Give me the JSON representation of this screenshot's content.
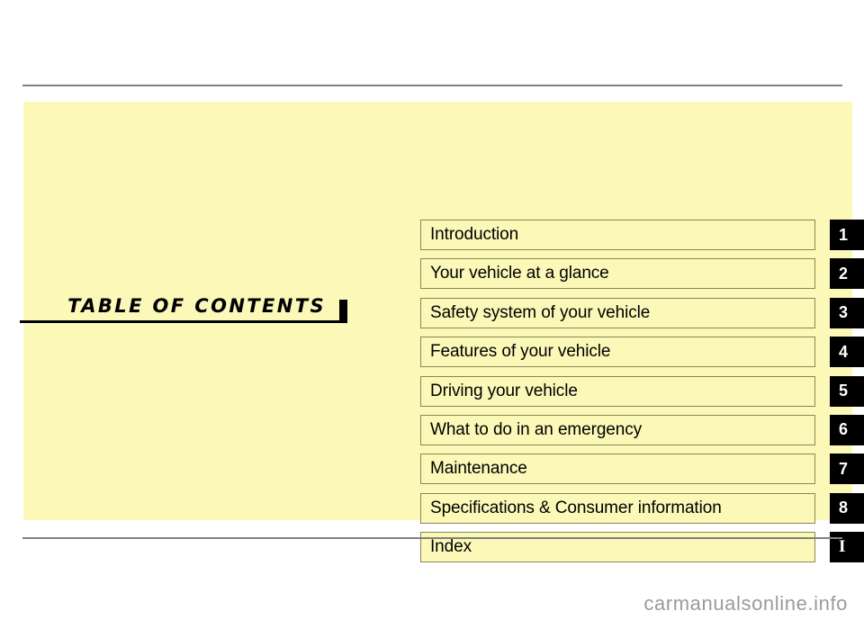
{
  "page": {
    "title": "TABLE OF CONTENTS",
    "title_plain": "TABLE OF CONTENTS",
    "panel_color": "#fbf8b8",
    "rule_color": "#808080",
    "tab_color": "#000000",
    "tab_text_color": "#ffffff"
  },
  "contents": {
    "rows": [
      {
        "label": "Introduction",
        "tab": "1"
      },
      {
        "label": "Your vehicle at a glance",
        "tab": "2"
      },
      {
        "label": "Safety system of your vehicle",
        "tab": "3"
      },
      {
        "label": "Features of your vehicle",
        "tab": "4"
      },
      {
        "label": "Driving your vehicle",
        "tab": "5"
      },
      {
        "label": "What to do in an emergency",
        "tab": "6"
      },
      {
        "label": "Maintenance",
        "tab": "7"
      },
      {
        "label": "Specifications & Consumer information",
        "tab": "8"
      },
      {
        "label": "Index",
        "tab": "I"
      }
    ]
  },
  "footer": {
    "watermark": "carmanualsonline.info"
  }
}
